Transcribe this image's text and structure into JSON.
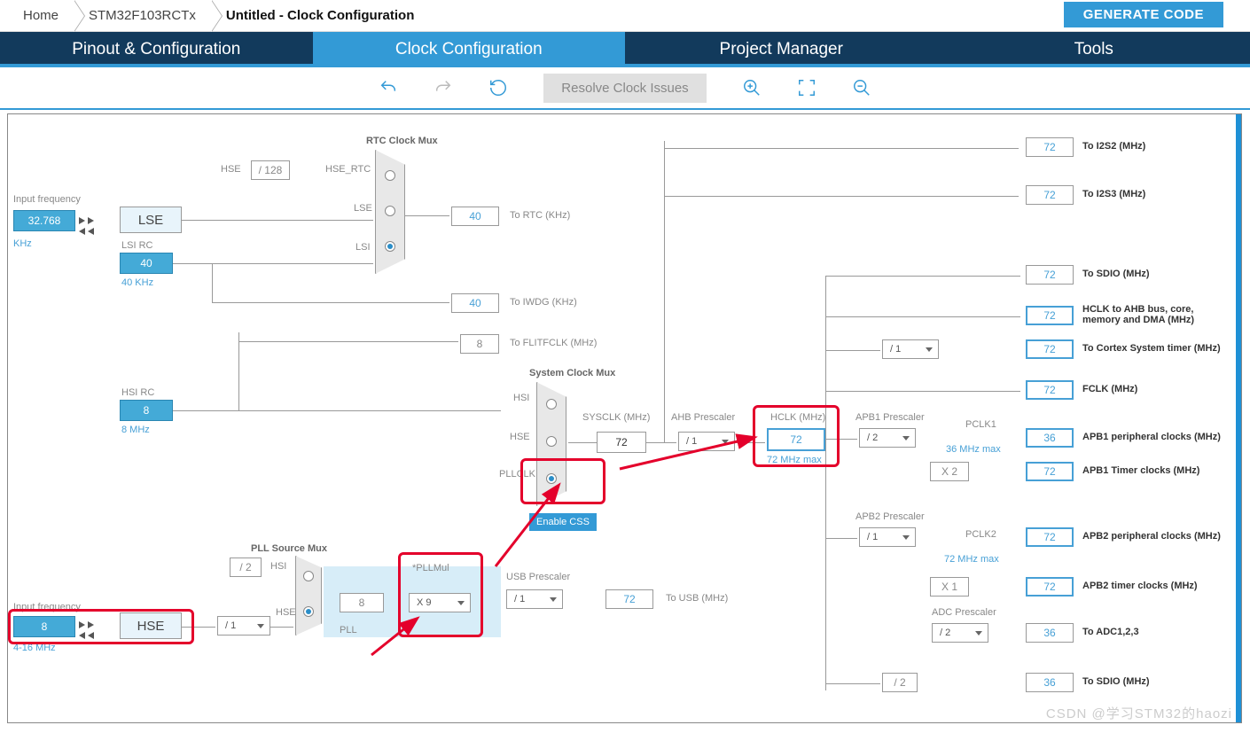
{
  "breadcrumb": {
    "home": "Home",
    "device": "STM32F103RCTx",
    "page": "Untitled - Clock Configuration"
  },
  "gen_code": "GENERATE CODE",
  "tabs": {
    "pinout": "Pinout & Configuration",
    "clock": "Clock Configuration",
    "pm": "Project Manager",
    "tools": "Tools"
  },
  "toolbar": {
    "resolve": "Resolve Clock Issues"
  },
  "labels": {
    "input_freq": "Input frequency",
    "khz": "KHz",
    "mhz_range": "4-16 MHz",
    "lse": "LSE",
    "lsi_rc": "LSI RC",
    "lsi_sub": "40 KHz",
    "hsi_rc": "HSI RC",
    "hsi_sub": "8 MHz",
    "hse": "HSE",
    "hse_div": "/ 128",
    "pll_src_mux": "PLL Source Mux",
    "hsi": "HSI",
    "pll": "PLL",
    "pllmul": "*PLLMul",
    "rtc_mux": "RTC Clock Mux",
    "hse_rtc": "HSE_RTC",
    "sys_mux": "System Clock Mux",
    "pllclk": "PLLCLK",
    "enable_css": "Enable CSS",
    "sysclk": "SYSCLK (MHz)",
    "ahb_pres": "AHB Prescaler",
    "hclk": "HCLK (MHz)",
    "hclk_max": "72 MHz max",
    "apb1_pres": "APB1 Prescaler",
    "apb2_pres": "APB2 Prescaler",
    "pclk1": "PCLK1",
    "pclk1_max": "36 MHz max",
    "pclk2": "PCLK2",
    "pclk2_max": "72 MHz max",
    "adc_pres": "ADC Prescaler",
    "usb_pres": "USB Prescaler",
    "to_rtc": "To RTC (KHz)",
    "to_iwdg": "To IWDG (KHz)",
    "to_flitf": "To FLITFCLK (MHz)",
    "to_usb": "To USB (MHz)",
    "to_i2s2": "To I2S2 (MHz)",
    "to_i2s3": "To I2S3 (MHz)",
    "to_sdio": "To SDIO (MHz)",
    "to_sdio2": "To SDIO (MHz)",
    "hclk_ahb": "HCLK to AHB bus, core, memory and DMA (MHz)",
    "to_cortex": "To Cortex System timer (MHz)",
    "fclk": "FCLK (MHz)",
    "apb1_periph": "APB1 peripheral clocks (MHz)",
    "apb1_timer": "APB1 Timer clocks (MHz)",
    "apb2_periph": "APB2 peripheral clocks (MHz)",
    "apb2_timer": "APB2 timer clocks (MHz)",
    "to_adc": "To ADC1,2,3"
  },
  "vals": {
    "lse": "32.768",
    "lsi": "40",
    "hsi": "8",
    "hse_in": "8",
    "hse_div2": "/ 2",
    "hse_presc": "/ 1",
    "pll_in": "8",
    "pllmul_sel": "X 9",
    "rtc": "40",
    "iwdg": "40",
    "flitf": "8",
    "sysclk": "72",
    "ahb_presc": "/ 1",
    "hclk": "72",
    "cortex_presc": "/ 1",
    "apb1_presc": "/ 2",
    "apb1_mul": "X 2",
    "apb2_presc": "/ 1",
    "apb2_mul": "X 1",
    "adc_presc": "/ 2",
    "sdio2_presc": "/ 2",
    "usb_presc": "/ 1",
    "i2s2": "72",
    "i2s3": "72",
    "sdio": "72",
    "hclk_ahb": "72",
    "cortex": "72",
    "fclk": "72",
    "pclk1": "36",
    "apb1_timer": "72",
    "pclk2": "72",
    "apb2_timer": "72",
    "adc": "36",
    "usb": "72",
    "sdio2": "36"
  },
  "watermark": "CSDN @学习STM32的haozi"
}
